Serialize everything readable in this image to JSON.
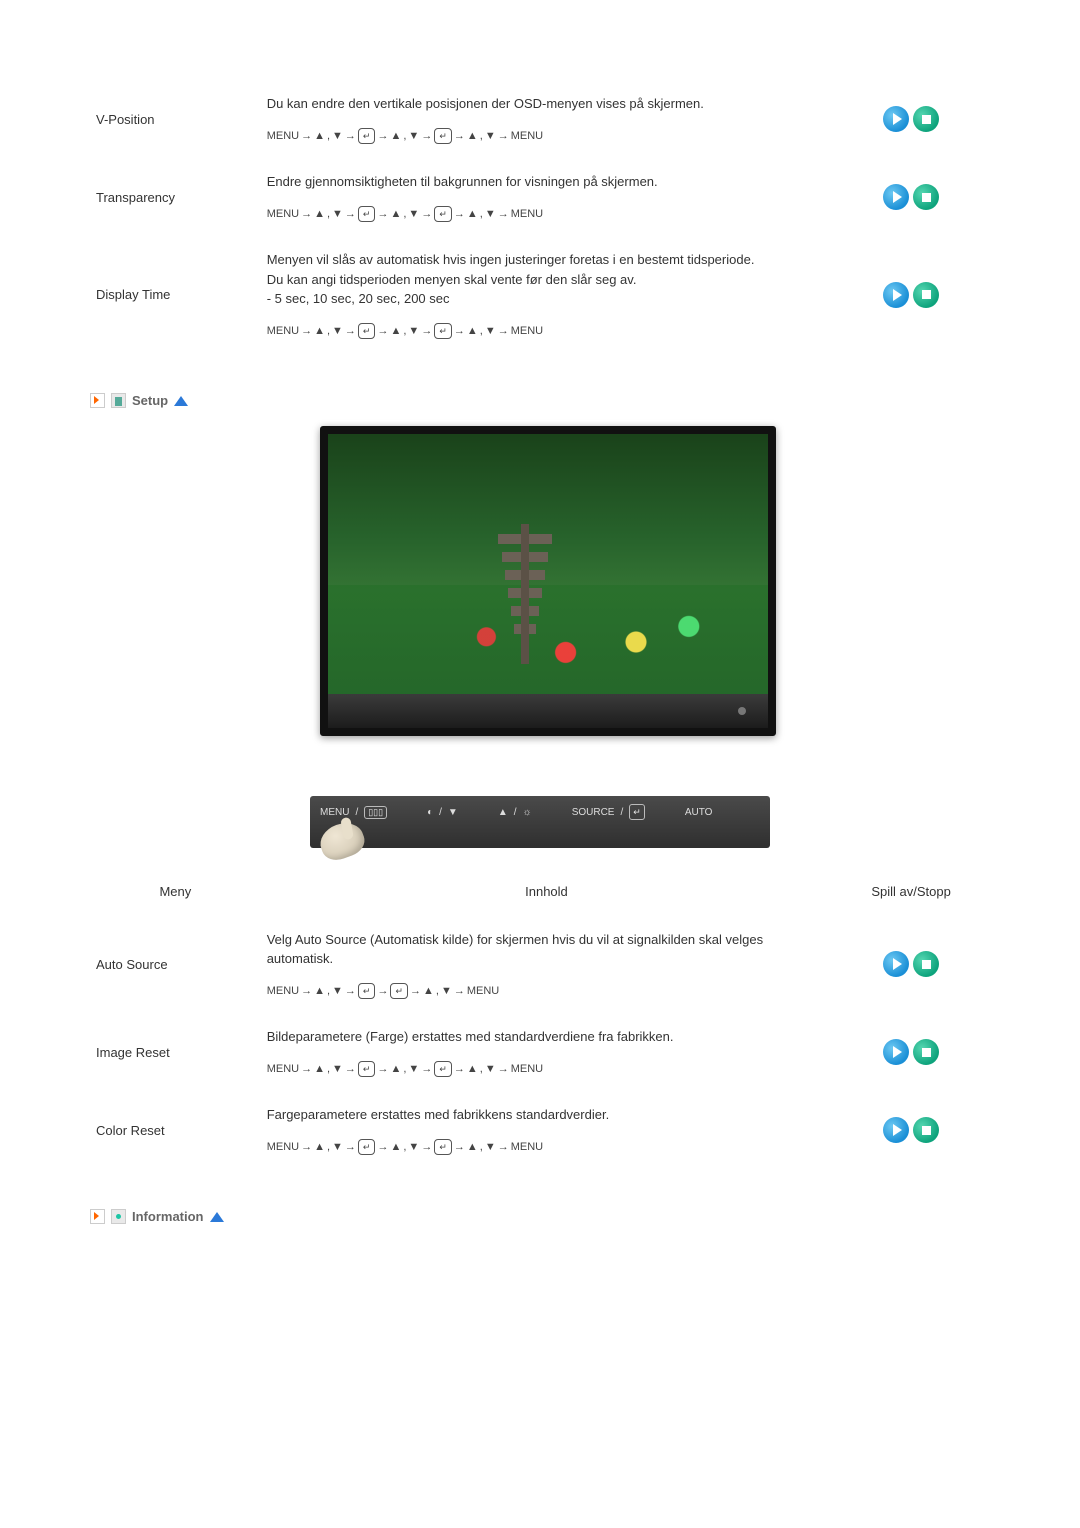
{
  "top_rows": [
    {
      "name": "V-Position",
      "desc": "Du kan endre den vertikale posisjonen der OSD-menyen vises på skjermen.",
      "steps_variant": "long"
    },
    {
      "name": "Transparency",
      "desc": "Endre gjennomsiktigheten til bakgrunnen for visningen på skjermen.",
      "steps_variant": "long"
    },
    {
      "name": "Display Time",
      "desc": "Menyen vil slås av automatisk hvis ingen justeringer foretas i en bestemt tidsperiode.\nDu kan angi tidsperioden menyen skal vente før den slår seg av.\n- 5 sec, 10 sec, 20 sec, 200 sec",
      "steps_variant": "long"
    }
  ],
  "section_setup": "Setup",
  "control_bar": {
    "menu": "MENU",
    "source": "SOURCE",
    "auto": "AUTO"
  },
  "table_headers": {
    "col1": "Meny",
    "col2": "Innhold",
    "col3": "Spill av/Stopp"
  },
  "setup_rows": [
    {
      "name": "Auto Source",
      "desc": "Velg Auto Source (Automatisk kilde) for skjermen hvis du vil at signalkilden skal velges automatisk.",
      "steps_variant": "short"
    },
    {
      "name": "Image Reset",
      "desc": "Bildeparametere (Farge) erstattes med standardverdiene fra fabrikken.",
      "steps_variant": "long"
    },
    {
      "name": "Color Reset",
      "desc": "Fargeparametere erstattes med fabrikkens standardverdier.",
      "steps_variant": "long"
    }
  ],
  "section_info": "Information",
  "glyphs": {
    "menu": "MENU",
    "arrow": "→",
    "up": "▲",
    "down": "▼",
    "comma": " , ",
    "enter": "↵"
  }
}
